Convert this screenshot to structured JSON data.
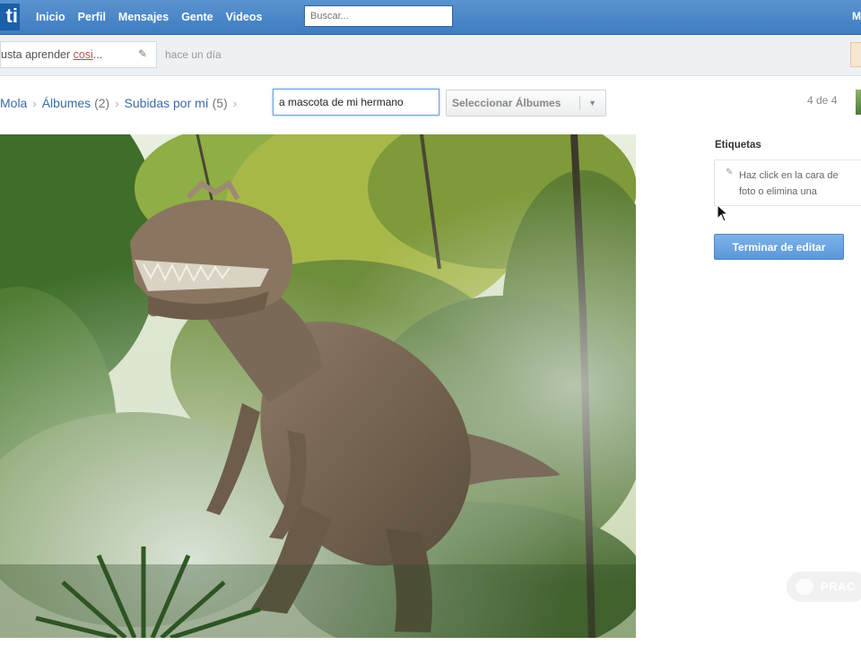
{
  "topbar": {
    "logo": "ti",
    "nav": [
      "Inicio",
      "Perfil",
      "Mensajes",
      "Gente",
      "Videos"
    ],
    "search_placeholder": "Buscar...",
    "user_initial": "M"
  },
  "status": {
    "text_prefix": "usta aprender ",
    "text_underlined": "cosi",
    "text_suffix": "...",
    "time": "hace un día"
  },
  "breadcrumb": {
    "root": "Mola",
    "albums_label": "Álbumes",
    "albums_count": "(2)",
    "uploads_label": "Subidas por mí",
    "uploads_count": "(5)"
  },
  "photo_title_value": "a mascota de mi hermano",
  "album_select_label": "Seleccionar Álbumes",
  "pager": "4 de 4",
  "tags": {
    "label": "Etiquetas",
    "help_line1": "Haz click en la cara de",
    "help_line2": "foto o elimina una"
  },
  "finish_button": "Terminar de editar",
  "watermark": "PRAC"
}
